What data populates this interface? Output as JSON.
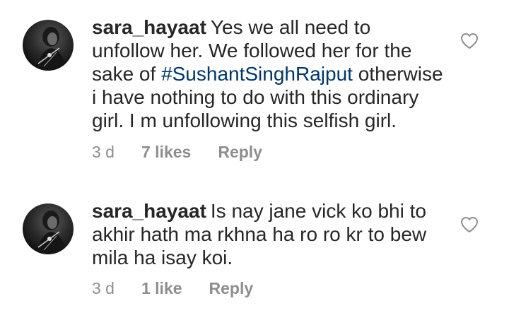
{
  "comments": [
    {
      "username": "sara_hayaat",
      "text_before": "Yes we all need to unfollow her. We followed her for the sake of ",
      "hashtag": "#SushantSinghRajput",
      "text_after": " otherwise i have nothing to do with this ordinary girl. I m unfollowing this selfish girl.",
      "time": "3 d",
      "likes": "7 likes",
      "reply_label": "Reply",
      "like_icon": "heart-outline-icon"
    },
    {
      "username": "sara_hayaat",
      "text_before": "Is nay jane vick ko bhi to akhir hath ma rkhna ha ro ro kr to bew mila ha isay koi.",
      "hashtag": "",
      "text_after": "",
      "time": "3 d",
      "likes": "1 like",
      "reply_label": "Reply",
      "like_icon": "heart-outline-icon"
    }
  ],
  "colors": {
    "text": "#262626",
    "muted": "#8e8e8e",
    "hashtag": "#00376b",
    "background": "#ffffff"
  }
}
